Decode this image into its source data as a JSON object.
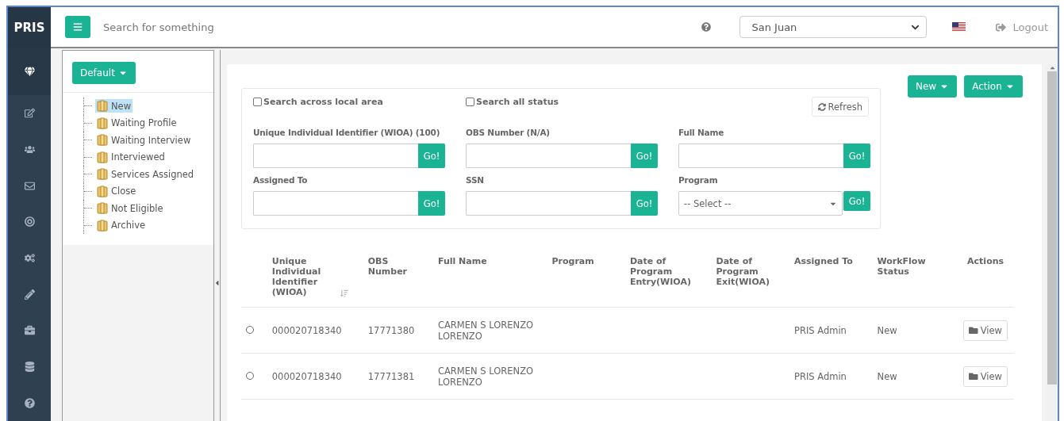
{
  "brand": "PRIS",
  "sidebar": {
    "items": [
      {
        "selected": true
      },
      {
        "selected": false
      },
      {
        "selected": false
      },
      {
        "selected": false
      },
      {
        "selected": false
      },
      {
        "selected": false
      },
      {
        "selected": false
      },
      {
        "selected": false
      },
      {
        "selected": false
      },
      {
        "selected": false
      }
    ]
  },
  "topbar": {
    "search_placeholder": "Search for something",
    "location": "San Juan",
    "logout": "Logout"
  },
  "tree": {
    "view_button": "Default",
    "items": [
      {
        "label": "New",
        "selected": true
      },
      {
        "label": "Waiting Profile",
        "selected": false
      },
      {
        "label": "Waiting Interview",
        "selected": false
      },
      {
        "label": "Interviewed",
        "selected": false
      },
      {
        "label": "Services Assigned",
        "selected": false
      },
      {
        "label": "Close",
        "selected": false
      },
      {
        "label": "Not Eligible",
        "selected": false
      },
      {
        "label": "Archive",
        "selected": false
      }
    ]
  },
  "toolbar": {
    "buttons": [
      "New",
      "Action"
    ]
  },
  "filters": {
    "checkboxes": [
      {
        "label": "Search across local area",
        "checked": false
      },
      {
        "label": "Search all status",
        "checked": false
      }
    ],
    "refresh": "Refresh",
    "fields": [
      {
        "label": "Unique Individual Identifier (WIOA) (100)",
        "kind": "text",
        "button": "Go!"
      },
      {
        "label": "OBS Number (N/A)",
        "kind": "text",
        "button": "Go!"
      },
      {
        "label": "Full Name",
        "kind": "text",
        "button": "Go!"
      },
      {
        "label": "Assigned To",
        "kind": "text",
        "button": "Go!"
      },
      {
        "label": "SSN",
        "kind": "text",
        "button": "Go!"
      },
      {
        "label": "Program",
        "kind": "select",
        "placeholder": "-- Select --",
        "button": "Go!"
      }
    ]
  },
  "table": {
    "columns": [
      "Unique Individual Identifier (WIOA)",
      "OBS Number",
      "Full Name",
      "Program",
      "Date of Program Entry(WIOA)",
      "Date of Program Exit(WIOA)",
      "Assigned To",
      "WorkFlow Status",
      "Actions"
    ],
    "rows": [
      {
        "selected": false,
        "uid": "000020718340",
        "obs": "17771380",
        "full_name": "CARMEN S LORENZO LORENZO",
        "assigned_to": "PRIS Admin",
        "status": "New",
        "action": "View"
      },
      {
        "selected": false,
        "uid": "000020718340",
        "obs": "17771381",
        "full_name": "CARMEN S LORENZO LORENZO",
        "assigned_to": "PRIS Admin",
        "status": "New",
        "action": "View"
      }
    ]
  }
}
